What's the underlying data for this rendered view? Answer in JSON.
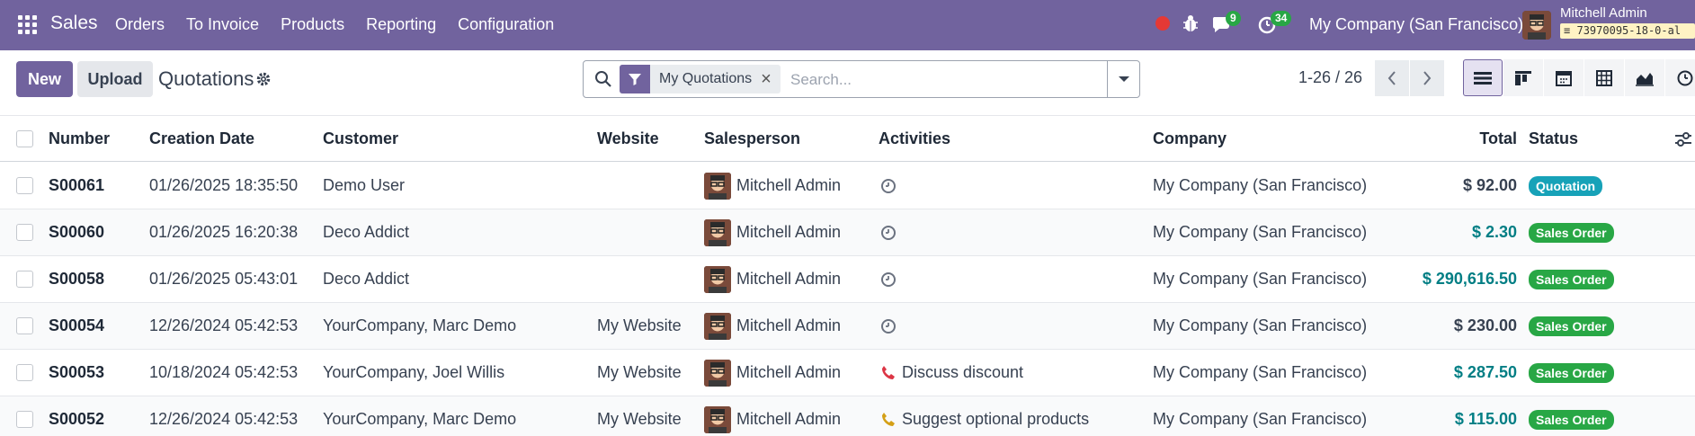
{
  "app": {
    "name": "Sales"
  },
  "nav": {
    "menu": [
      "Orders",
      "To Invoice",
      "Products",
      "Reporting",
      "Configuration"
    ],
    "messages_count": "9",
    "activities_count": "34",
    "company": "My Company (San Francisco)",
    "user_name": "Mitchell Admin",
    "database": "73970095-18-0-al"
  },
  "control": {
    "new_label": "New",
    "upload_label": "Upload",
    "title": "Quotations",
    "facet_label": "My Quotations",
    "search_placeholder": "Search...",
    "pager": "1-26 / 26"
  },
  "table": {
    "headers": {
      "number": "Number",
      "date": "Creation Date",
      "customer": "Customer",
      "website": "Website",
      "salesperson": "Salesperson",
      "activities": "Activities",
      "company": "Company",
      "total": "Total",
      "status": "Status"
    },
    "rows": [
      {
        "number": "S00061",
        "date": "01/26/2025 18:35:50",
        "customer": "Demo User",
        "website": "",
        "salesperson": "Mitchell Admin",
        "activity_icon": "clock-icon",
        "activity_text": "",
        "company": "My Company (San Francisco)",
        "total": "$ 92.00",
        "total_style": "plain",
        "status": "Quotation",
        "status_color": "#17a2b8"
      },
      {
        "number": "S00060",
        "date": "01/26/2025 16:20:38",
        "customer": "Deco Addict",
        "website": "",
        "salesperson": "Mitchell Admin",
        "activity_icon": "clock-icon",
        "activity_text": "",
        "company": "My Company (San Francisco)",
        "total": "$ 2.30",
        "total_style": "link",
        "status": "Sales Order",
        "status_color": "#28a745"
      },
      {
        "number": "S00058",
        "date": "01/26/2025 05:43:01",
        "customer": "Deco Addict",
        "website": "",
        "salesperson": "Mitchell Admin",
        "activity_icon": "clock-icon",
        "activity_text": "",
        "company": "My Company (San Francisco)",
        "total": "$ 290,616.50",
        "total_style": "link",
        "status": "Sales Order",
        "status_color": "#28a745"
      },
      {
        "number": "S00054",
        "date": "12/26/2024 05:42:53",
        "customer": "YourCompany, Marc Demo",
        "website": "My Website",
        "salesperson": "Mitchell Admin",
        "activity_icon": "clock-icon",
        "activity_text": "",
        "company": "My Company (San Francisco)",
        "total": "$ 230.00",
        "total_style": "plain",
        "status": "Sales Order",
        "status_color": "#28a745"
      },
      {
        "number": "S00053",
        "date": "10/18/2024 05:42:53",
        "customer": "YourCompany, Joel Willis",
        "website": "My Website",
        "salesperson": "Mitchell Admin",
        "activity_icon": "phone-icon",
        "activity_color": "#dc3545",
        "activity_text": "Discuss discount",
        "company": "My Company (San Francisco)",
        "total": "$ 287.50",
        "total_style": "link",
        "status": "Sales Order",
        "status_color": "#28a745"
      },
      {
        "number": "S00052",
        "date": "12/26/2024 05:42:53",
        "customer": "YourCompany, Marc Demo",
        "website": "My Website",
        "salesperson": "Mitchell Admin",
        "activity_icon": "phone-icon",
        "activity_color": "#d4a017",
        "activity_text": "Suggest optional products",
        "company": "My Company (San Francisco)",
        "total": "$ 115.00",
        "total_style": "link",
        "status": "Sales Order",
        "status_color": "#28a745"
      }
    ]
  },
  "colors": {
    "brand": "#71639e",
    "link": "#017e84"
  }
}
